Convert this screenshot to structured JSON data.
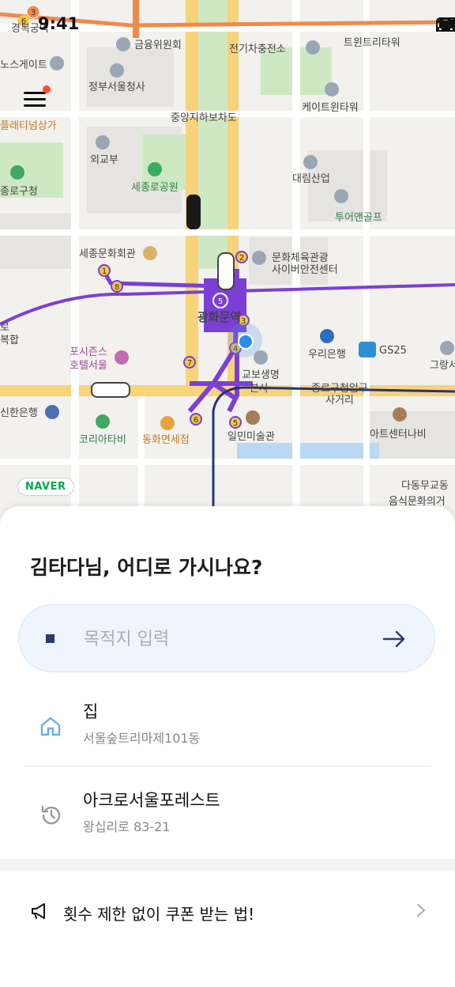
{
  "status_bar": {
    "time": "9:41"
  },
  "map": {
    "poi_labels": [
      "금융위원회",
      "전기차충전소",
      "트윈트리타워",
      "노스게이트",
      "정부서울청사",
      "케이트윈타워",
      "중앙지하보차도",
      "플래티넘상가",
      "외교부",
      "세종로공원",
      "대림산업",
      "투어앤골프",
      "종로구청",
      "세종문화회관",
      "문화체육관광",
      "사이버안전센터",
      "광화문역",
      "우리은행",
      "GS25",
      "그랑서",
      "포시즌스",
      "호텔서울",
      "교보생명",
      "본사",
      "종로구청입구",
      "사거리",
      "신한은행",
      "코리아타비",
      "동화면세점",
      "일민미술관",
      "아트센터나비",
      "다동무교동",
      "음식문화의거",
      "경복궁역",
      "로",
      "복합"
    ],
    "station_numbers": [
      "3",
      "6",
      "1",
      "8",
      "2",
      "5",
      "3",
      "4",
      "7",
      "6",
      "5"
    ],
    "brand": "NAVER"
  },
  "sheet": {
    "greeting": "김타다님, 어디로 가시나요?",
    "search": {
      "placeholder": "목적지 입력",
      "value": ""
    },
    "places": [
      {
        "title": "집",
        "subtitle": "서울숲트리마제101동",
        "icon": "home-icon"
      },
      {
        "title": "아크로서울포레스트",
        "subtitle": "왕십리로 83-21",
        "icon": "history-icon"
      }
    ],
    "promo": {
      "text": "횟수 제한 없이 쿠폰 받는 법!",
      "icon": "megaphone-icon"
    }
  },
  "colors": {
    "accent": "#7b3fd6",
    "location": "#2b8cf0",
    "menu_dot": "#ff4b2b",
    "search_bg": "#eef5fc"
  }
}
